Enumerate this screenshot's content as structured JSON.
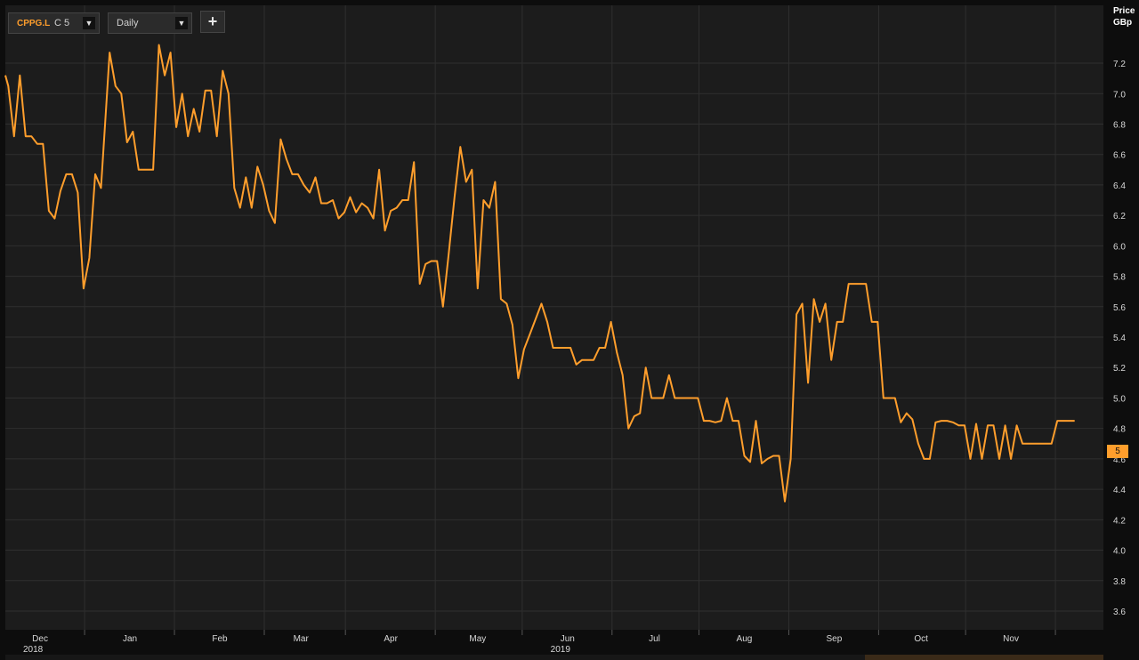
{
  "toolbar": {
    "instrument": "CPPG.L",
    "field": "C 5",
    "period": "Daily",
    "add_label": "+"
  },
  "axis": {
    "title_line1": "Price",
    "title_line2": "GBp",
    "last_price_tag": "5"
  },
  "colors": {
    "background": "#1c1c1c",
    "grid": "#2f2f2f",
    "line": "#ff9e2c",
    "text": "#d8d8d8"
  },
  "icons": {
    "ric_dropdown": "dropdown-arrow-icon",
    "period_dropdown": "dropdown-arrow-icon",
    "add": "plus-icon"
  },
  "chart_data": {
    "type": "line",
    "title": "",
    "xlabel": "",
    "ylabel": "Price GBp",
    "ylim": [
      3.5,
      7.4
    ],
    "yticks": [
      3.6,
      3.8,
      4.0,
      4.2,
      4.4,
      4.6,
      4.8,
      5.0,
      5.2,
      5.4,
      5.6,
      5.8,
      6.0,
      6.2,
      6.4,
      6.6,
      6.8,
      7.0,
      7.2
    ],
    "x_domain": [
      "2018-11-19",
      "2019-11-28"
    ],
    "x_ticks": [
      {
        "date": "2018-12-01",
        "label": "Dec",
        "year": "2018"
      },
      {
        "date": "2019-01-01",
        "label": "Jan",
        "year": ""
      },
      {
        "date": "2019-02-01",
        "label": "Feb",
        "year": ""
      },
      {
        "date": "2019-03-01",
        "label": "Mar",
        "year": ""
      },
      {
        "date": "2019-04-01",
        "label": "Apr",
        "year": ""
      },
      {
        "date": "2019-05-01",
        "label": "May",
        "year": ""
      },
      {
        "date": "2019-06-01",
        "label": "Jun",
        "year": "2019"
      },
      {
        "date": "2019-07-01",
        "label": "Jul",
        "year": ""
      },
      {
        "date": "2019-08-01",
        "label": "Aug",
        "year": ""
      },
      {
        "date": "2019-09-01",
        "label": "Sep",
        "year": ""
      },
      {
        "date": "2019-10-01",
        "label": "Oct",
        "year": ""
      },
      {
        "date": "2019-11-01",
        "label": "Nov",
        "year": ""
      }
    ],
    "grid": true,
    "legend": "none",
    "series": [
      {
        "name": "CPPG.L",
        "points": [
          [
            "2018-11-19",
            7.12
          ],
          [
            "2018-11-20",
            7.05
          ],
          [
            "2018-11-22",
            6.72
          ],
          [
            "2018-11-24",
            7.12
          ],
          [
            "2018-11-26",
            6.72
          ],
          [
            "2018-11-28",
            6.72
          ],
          [
            "2018-11-30",
            6.67
          ],
          [
            "2018-12-02",
            6.67
          ],
          [
            "2018-12-04",
            6.23
          ],
          [
            "2018-12-06",
            6.18
          ],
          [
            "2018-12-08",
            6.36
          ],
          [
            "2018-12-10",
            6.47
          ],
          [
            "2018-12-12",
            6.47
          ],
          [
            "2018-12-14",
            6.35
          ],
          [
            "2018-12-16",
            5.72
          ],
          [
            "2018-12-18",
            5.92
          ],
          [
            "2018-12-20",
            6.47
          ],
          [
            "2018-12-22",
            6.38
          ],
          [
            "2018-12-25",
            7.27
          ],
          [
            "2018-12-27",
            7.05
          ],
          [
            "2018-12-29",
            7.0
          ],
          [
            "2018-12-31",
            6.68
          ],
          [
            "2019-01-02",
            6.75
          ],
          [
            "2019-01-04",
            6.5
          ],
          [
            "2019-01-07",
            6.5
          ],
          [
            "2019-01-09",
            6.5
          ],
          [
            "2019-01-11",
            7.32
          ],
          [
            "2019-01-13",
            7.12
          ],
          [
            "2019-01-15",
            7.27
          ],
          [
            "2019-01-17",
            6.78
          ],
          [
            "2019-01-19",
            7.0
          ],
          [
            "2019-01-21",
            6.72
          ],
          [
            "2019-01-23",
            6.9
          ],
          [
            "2019-01-25",
            6.75
          ],
          [
            "2019-01-27",
            7.02
          ],
          [
            "2019-01-29",
            7.02
          ],
          [
            "2019-01-31",
            6.72
          ],
          [
            "2019-02-02",
            7.15
          ],
          [
            "2019-02-04",
            7.0
          ],
          [
            "2019-02-06",
            6.38
          ],
          [
            "2019-02-08",
            6.25
          ],
          [
            "2019-02-10",
            6.45
          ],
          [
            "2019-02-12",
            6.25
          ],
          [
            "2019-02-14",
            6.52
          ],
          [
            "2019-02-16",
            6.4
          ],
          [
            "2019-02-18",
            6.23
          ],
          [
            "2019-02-20",
            6.15
          ],
          [
            "2019-02-22",
            6.7
          ],
          [
            "2019-02-24",
            6.57
          ],
          [
            "2019-02-26",
            6.47
          ],
          [
            "2019-02-28",
            6.47
          ],
          [
            "2019-03-02",
            6.4
          ],
          [
            "2019-03-04",
            6.35
          ],
          [
            "2019-03-06",
            6.45
          ],
          [
            "2019-03-08",
            6.28
          ],
          [
            "2019-03-10",
            6.28
          ],
          [
            "2019-03-12",
            6.3
          ],
          [
            "2019-03-14",
            6.18
          ],
          [
            "2019-03-16",
            6.22
          ],
          [
            "2019-03-18",
            6.32
          ],
          [
            "2019-03-20",
            6.22
          ],
          [
            "2019-03-22",
            6.28
          ],
          [
            "2019-03-24",
            6.25
          ],
          [
            "2019-03-26",
            6.18
          ],
          [
            "2019-03-28",
            6.5
          ],
          [
            "2019-03-30",
            6.1
          ],
          [
            "2019-04-01",
            6.23
          ],
          [
            "2019-04-03",
            6.25
          ],
          [
            "2019-04-05",
            6.3
          ],
          [
            "2019-04-07",
            6.3
          ],
          [
            "2019-04-09",
            6.55
          ],
          [
            "2019-04-11",
            5.75
          ],
          [
            "2019-04-13",
            5.88
          ],
          [
            "2019-04-15",
            5.9
          ],
          [
            "2019-04-17",
            5.9
          ],
          [
            "2019-04-19",
            5.6
          ],
          [
            "2019-04-21",
            5.95
          ],
          [
            "2019-04-23",
            6.32
          ],
          [
            "2019-04-25",
            6.65
          ],
          [
            "2019-04-27",
            6.42
          ],
          [
            "2019-04-29",
            6.5
          ],
          [
            "2019-05-01",
            5.72
          ],
          [
            "2019-05-03",
            6.3
          ],
          [
            "2019-05-05",
            6.25
          ],
          [
            "2019-05-07",
            6.42
          ],
          [
            "2019-05-09",
            5.65
          ],
          [
            "2019-05-11",
            5.62
          ],
          [
            "2019-05-13",
            5.48
          ],
          [
            "2019-05-15",
            5.13
          ],
          [
            "2019-05-17",
            5.32
          ],
          [
            "2019-05-19",
            5.42
          ],
          [
            "2019-05-21",
            5.52
          ],
          [
            "2019-05-23",
            5.62
          ],
          [
            "2019-05-25",
            5.5
          ],
          [
            "2019-05-27",
            5.33
          ],
          [
            "2019-05-29",
            5.33
          ],
          [
            "2019-05-31",
            5.33
          ],
          [
            "2019-06-02",
            5.33
          ],
          [
            "2019-06-04",
            5.22
          ],
          [
            "2019-06-06",
            5.25
          ],
          [
            "2019-06-08",
            5.25
          ],
          [
            "2019-06-10",
            5.25
          ],
          [
            "2019-06-12",
            5.33
          ],
          [
            "2019-06-14",
            5.33
          ],
          [
            "2019-06-16",
            5.5
          ],
          [
            "2019-06-18",
            5.3
          ],
          [
            "2019-06-20",
            5.15
          ],
          [
            "2019-06-22",
            4.8
          ],
          [
            "2019-06-24",
            4.88
          ],
          [
            "2019-06-26",
            4.9
          ],
          [
            "2019-06-28",
            5.2
          ],
          [
            "2019-06-30",
            5.0
          ],
          [
            "2019-07-02",
            5.0
          ],
          [
            "2019-07-04",
            5.0
          ],
          [
            "2019-07-06",
            5.15
          ],
          [
            "2019-07-08",
            5.0
          ],
          [
            "2019-07-10",
            5.0
          ],
          [
            "2019-07-12",
            5.0
          ],
          [
            "2019-07-14",
            5.0
          ],
          [
            "2019-07-16",
            5.0
          ],
          [
            "2019-07-18",
            4.85
          ],
          [
            "2019-07-20",
            4.85
          ],
          [
            "2019-07-22",
            4.84
          ],
          [
            "2019-07-24",
            4.85
          ],
          [
            "2019-07-26",
            5.0
          ],
          [
            "2019-07-28",
            4.85
          ],
          [
            "2019-07-30",
            4.85
          ],
          [
            "2019-08-01",
            4.62
          ],
          [
            "2019-08-03",
            4.58
          ],
          [
            "2019-08-05",
            4.85
          ],
          [
            "2019-08-07",
            4.57
          ],
          [
            "2019-08-09",
            4.6
          ],
          [
            "2019-08-11",
            4.62
          ],
          [
            "2019-08-13",
            4.62
          ],
          [
            "2019-08-15",
            4.32
          ],
          [
            "2019-08-17",
            4.6
          ],
          [
            "2019-08-19",
            5.55
          ],
          [
            "2019-08-21",
            5.62
          ],
          [
            "2019-08-23",
            5.1
          ],
          [
            "2019-08-25",
            5.65
          ],
          [
            "2019-08-27",
            5.5
          ],
          [
            "2019-08-29",
            5.62
          ],
          [
            "2019-08-31",
            5.25
          ],
          [
            "2019-09-02",
            5.5
          ],
          [
            "2019-09-04",
            5.5
          ],
          [
            "2019-09-06",
            5.75
          ],
          [
            "2019-09-08",
            5.75
          ],
          [
            "2019-09-10",
            5.75
          ],
          [
            "2019-09-12",
            5.75
          ],
          [
            "2019-09-14",
            5.5
          ],
          [
            "2019-09-16",
            5.5
          ],
          [
            "2019-09-18",
            5.0
          ],
          [
            "2019-09-20",
            5.0
          ],
          [
            "2019-09-22",
            5.0
          ],
          [
            "2019-09-24",
            4.84
          ],
          [
            "2019-09-26",
            4.9
          ],
          [
            "2019-09-28",
            4.86
          ],
          [
            "2019-09-30",
            4.7
          ],
          [
            "2019-10-02",
            4.6
          ],
          [
            "2019-10-04",
            4.6
          ],
          [
            "2019-10-06",
            4.84
          ],
          [
            "2019-10-08",
            4.85
          ],
          [
            "2019-10-10",
            4.85
          ],
          [
            "2019-10-12",
            4.84
          ],
          [
            "2019-10-14",
            4.82
          ],
          [
            "2019-10-16",
            4.82
          ],
          [
            "2019-10-18",
            4.6
          ],
          [
            "2019-10-20",
            4.83
          ],
          [
            "2019-10-22",
            4.6
          ],
          [
            "2019-10-24",
            4.82
          ],
          [
            "2019-10-26",
            4.82
          ],
          [
            "2019-10-28",
            4.6
          ],
          [
            "2019-10-30",
            4.82
          ],
          [
            "2019-11-01",
            4.6
          ],
          [
            "2019-11-03",
            4.82
          ],
          [
            "2019-11-05",
            4.7
          ],
          [
            "2019-11-07",
            4.7
          ],
          [
            "2019-11-09",
            4.7
          ],
          [
            "2019-11-11",
            4.7
          ],
          [
            "2019-11-13",
            4.7
          ],
          [
            "2019-11-15",
            4.7
          ],
          [
            "2019-11-17",
            4.85
          ],
          [
            "2019-11-19",
            4.85
          ],
          [
            "2019-11-21",
            4.85
          ],
          [
            "2019-11-23",
            4.85
          ]
        ],
        "points_tail_note_removed": true,
        "tail": [
          [
            "2019-11-23",
            4.85
          ],
          [
            "2019-11-24",
            4.85
          ]
        ]
      }
    ]
  }
}
